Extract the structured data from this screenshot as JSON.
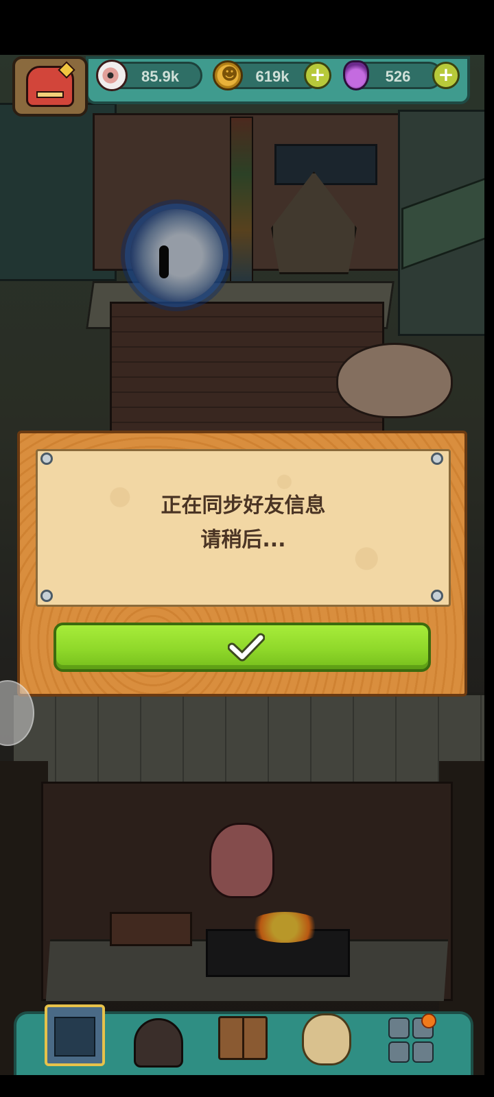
{
  "hud": {
    "eyeballs": "85.9k",
    "coins": "619k",
    "potions": "526"
  },
  "dialog": {
    "line1": "正在同步好友信息",
    "line2": "请稍后..."
  },
  "icons": {
    "resources": [
      "eyeball-icon",
      "coin-icon",
      "potion-icon"
    ],
    "confirm": "check-icon",
    "nav": [
      "shop-icon",
      "dungeon-icon",
      "book-icon",
      "sack-icon",
      "grid-icon"
    ]
  },
  "colors": {
    "hud_bg": "#3f9b8e",
    "confirm_green": "#8fd82a",
    "board_wood": "#d78b3a",
    "paper": "#f2d7a4",
    "text_brown": "#4a3424"
  }
}
